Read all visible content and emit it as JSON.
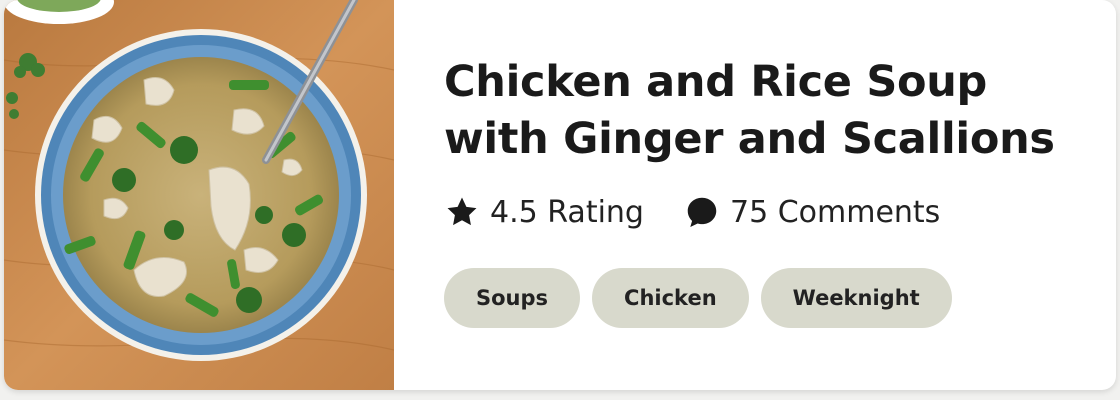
{
  "recipe": {
    "title_line1": "Chicken and Rice Soup",
    "title_line2": "with Ginger and Scallions",
    "image_alt": "Bowl of chicken and rice soup with scallions and cilantro"
  },
  "meta": {
    "rating_text": "4.5 Rating",
    "comments_text": "75 Comments",
    "rating_icon": "star-icon",
    "comments_icon": "speech-bubble-icon"
  },
  "tags": [
    "Soups",
    "Chicken",
    "Weeknight"
  ],
  "colors": {
    "tag_background": "#d8d9cc",
    "title": "#1a1a1a",
    "bowl_rim": "#4f86b8",
    "wood": "#c98a4f"
  }
}
